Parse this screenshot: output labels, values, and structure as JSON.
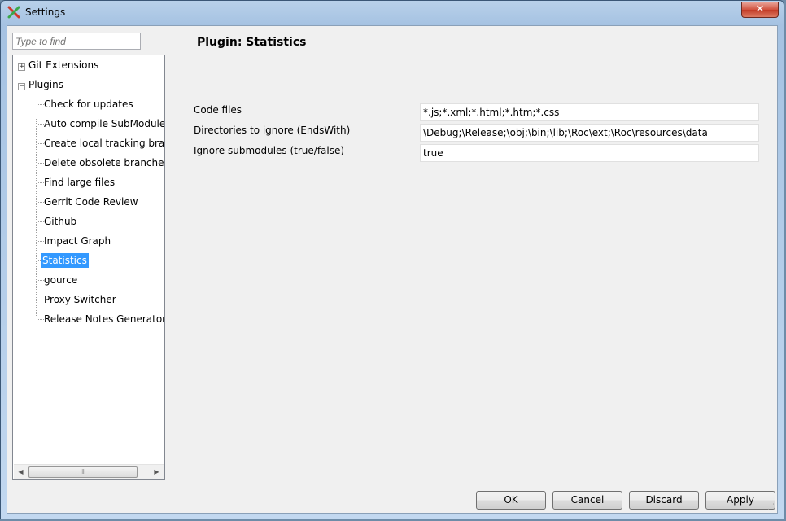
{
  "window": {
    "title": "Settings",
    "close_symbol": "✕"
  },
  "search": {
    "placeholder": "Type to find"
  },
  "tree": {
    "git_extensions": "Git Extensions",
    "plugins": "Plugins",
    "children": [
      "Check for updates",
      "Auto compile SubModules",
      "Create local tracking branc",
      "Delete obsolete branches",
      "Find large files",
      "Gerrit Code Review",
      "Github",
      "Impact Graph",
      "Statistics",
      "gource",
      "Proxy Switcher",
      "Release Notes Generator"
    ],
    "selected": "Statistics",
    "expand_symbol": "+",
    "collapse_symbol": "−",
    "scroll_left": "◀",
    "scroll_right": "▶",
    "scroll_grip": "III"
  },
  "plugin": {
    "heading": "Plugin: Statistics",
    "code_files_label": "Code files",
    "code_files_value": "*.js;*.xml;*.html;*.htm;*.css",
    "dirs_ignore_label": "Directories to ignore (EndsWith)",
    "dirs_ignore_value": "\\Debug;\\Release;\\obj;\\bin;\\lib;\\Roc\\ext;\\Roc\\resources\\data",
    "ignore_submodules_label": "Ignore submodules (true/false)",
    "ignore_submodules_value": "true"
  },
  "buttons": {
    "ok": "OK",
    "cancel": "Cancel",
    "discard": "Discard",
    "apply": "Apply"
  },
  "colors": {
    "selection": "#3399ff",
    "close_button": "#c94a36",
    "frame": "#a5c2e2"
  }
}
